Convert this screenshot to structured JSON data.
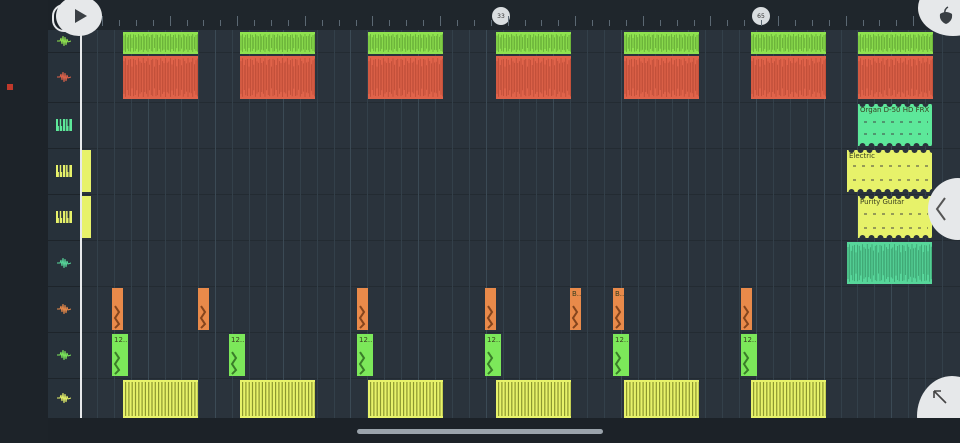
{
  "ruler": {
    "markers": [
      "33",
      "65"
    ]
  },
  "clips": {
    "organ": "Organ D-50 HD FRX",
    "electric": "Electric",
    "purity": "Purity Guitar",
    "b_short": "B...",
    "n12_short": "12..."
  },
  "colors": {
    "green": "#8fe24f",
    "red": "#e0634a",
    "mint": "#5de89a",
    "yellow": "#e7f26a",
    "teal": "#57d69a",
    "orange": "#e98a4a",
    "lime": "#7ce85a"
  },
  "icons": {
    "play": "play-icon",
    "fl_logo": "fl-fruit-logo-icon",
    "back": "chevron-left-icon",
    "expand": "arrow-up-left-icon",
    "tracks": [
      "waveform-icon",
      "waveform-icon",
      "piano-keys-icon",
      "piano-keys-icon",
      "piano-keys-icon",
      "waveform-icon",
      "waveform-icon",
      "waveform-icon",
      "waveform-icon"
    ]
  }
}
